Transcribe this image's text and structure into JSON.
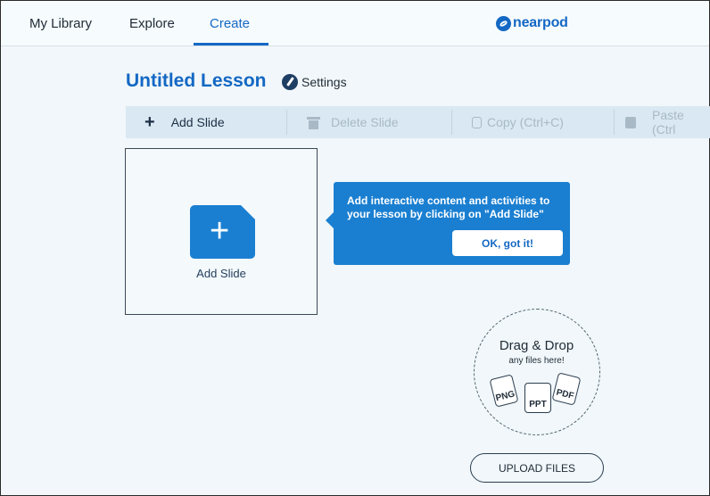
{
  "nav": {
    "tabs": [
      {
        "label": "My Library"
      },
      {
        "label": "Explore"
      },
      {
        "label": "Create"
      }
    ],
    "logo_text": "nearpod",
    "accent_color": "#1468c4"
  },
  "lesson": {
    "title": "Untitled Lesson",
    "settings_label": "Settings"
  },
  "toolbar": {
    "add_slide": "Add Slide",
    "delete_slide": "Delete Slide",
    "copy": "Copy (Ctrl+C)",
    "paste": "Paste (Ctrl"
  },
  "slide_card": {
    "label": "Add Slide"
  },
  "tooltip": {
    "text": "Add interactive content and activities to your lesson by clicking on \"Add Slide\"",
    "button": "OK, got it!"
  },
  "dropzone": {
    "title": "Drag & Drop",
    "subtitle": "any files here!",
    "file_types": [
      "PNG",
      "PPT",
      "PDF"
    ]
  },
  "upload_button": "UPLOAD FILES"
}
